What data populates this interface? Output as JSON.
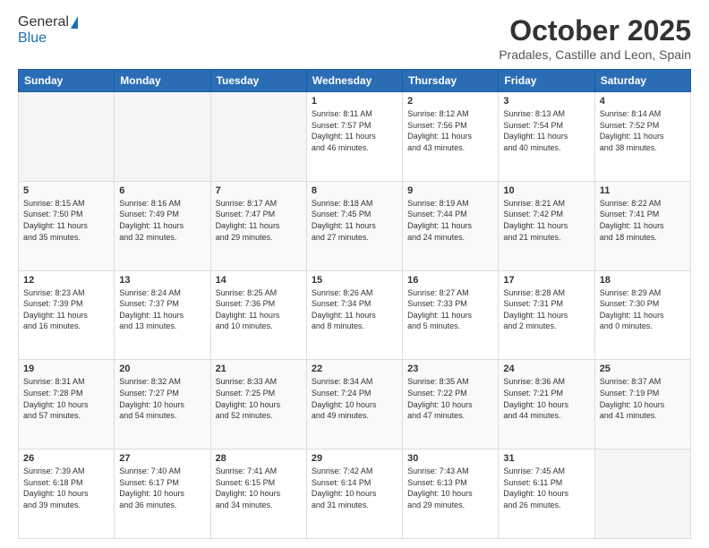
{
  "header": {
    "logo_general": "General",
    "logo_blue": "Blue",
    "month": "October 2025",
    "location": "Pradales, Castille and Leon, Spain"
  },
  "weekdays": [
    "Sunday",
    "Monday",
    "Tuesday",
    "Wednesday",
    "Thursday",
    "Friday",
    "Saturday"
  ],
  "weeks": [
    [
      {
        "day": "",
        "info": ""
      },
      {
        "day": "",
        "info": ""
      },
      {
        "day": "",
        "info": ""
      },
      {
        "day": "1",
        "info": "Sunrise: 8:11 AM\nSunset: 7:57 PM\nDaylight: 11 hours\nand 46 minutes."
      },
      {
        "day": "2",
        "info": "Sunrise: 8:12 AM\nSunset: 7:56 PM\nDaylight: 11 hours\nand 43 minutes."
      },
      {
        "day": "3",
        "info": "Sunrise: 8:13 AM\nSunset: 7:54 PM\nDaylight: 11 hours\nand 40 minutes."
      },
      {
        "day": "4",
        "info": "Sunrise: 8:14 AM\nSunset: 7:52 PM\nDaylight: 11 hours\nand 38 minutes."
      }
    ],
    [
      {
        "day": "5",
        "info": "Sunrise: 8:15 AM\nSunset: 7:50 PM\nDaylight: 11 hours\nand 35 minutes."
      },
      {
        "day": "6",
        "info": "Sunrise: 8:16 AM\nSunset: 7:49 PM\nDaylight: 11 hours\nand 32 minutes."
      },
      {
        "day": "7",
        "info": "Sunrise: 8:17 AM\nSunset: 7:47 PM\nDaylight: 11 hours\nand 29 minutes."
      },
      {
        "day": "8",
        "info": "Sunrise: 8:18 AM\nSunset: 7:45 PM\nDaylight: 11 hours\nand 27 minutes."
      },
      {
        "day": "9",
        "info": "Sunrise: 8:19 AM\nSunset: 7:44 PM\nDaylight: 11 hours\nand 24 minutes."
      },
      {
        "day": "10",
        "info": "Sunrise: 8:21 AM\nSunset: 7:42 PM\nDaylight: 11 hours\nand 21 minutes."
      },
      {
        "day": "11",
        "info": "Sunrise: 8:22 AM\nSunset: 7:41 PM\nDaylight: 11 hours\nand 18 minutes."
      }
    ],
    [
      {
        "day": "12",
        "info": "Sunrise: 8:23 AM\nSunset: 7:39 PM\nDaylight: 11 hours\nand 16 minutes."
      },
      {
        "day": "13",
        "info": "Sunrise: 8:24 AM\nSunset: 7:37 PM\nDaylight: 11 hours\nand 13 minutes."
      },
      {
        "day": "14",
        "info": "Sunrise: 8:25 AM\nSunset: 7:36 PM\nDaylight: 11 hours\nand 10 minutes."
      },
      {
        "day": "15",
        "info": "Sunrise: 8:26 AM\nSunset: 7:34 PM\nDaylight: 11 hours\nand 8 minutes."
      },
      {
        "day": "16",
        "info": "Sunrise: 8:27 AM\nSunset: 7:33 PM\nDaylight: 11 hours\nand 5 minutes."
      },
      {
        "day": "17",
        "info": "Sunrise: 8:28 AM\nSunset: 7:31 PM\nDaylight: 11 hours\nand 2 minutes."
      },
      {
        "day": "18",
        "info": "Sunrise: 8:29 AM\nSunset: 7:30 PM\nDaylight: 11 hours\nand 0 minutes."
      }
    ],
    [
      {
        "day": "19",
        "info": "Sunrise: 8:31 AM\nSunset: 7:28 PM\nDaylight: 10 hours\nand 57 minutes."
      },
      {
        "day": "20",
        "info": "Sunrise: 8:32 AM\nSunset: 7:27 PM\nDaylight: 10 hours\nand 54 minutes."
      },
      {
        "day": "21",
        "info": "Sunrise: 8:33 AM\nSunset: 7:25 PM\nDaylight: 10 hours\nand 52 minutes."
      },
      {
        "day": "22",
        "info": "Sunrise: 8:34 AM\nSunset: 7:24 PM\nDaylight: 10 hours\nand 49 minutes."
      },
      {
        "day": "23",
        "info": "Sunrise: 8:35 AM\nSunset: 7:22 PM\nDaylight: 10 hours\nand 47 minutes."
      },
      {
        "day": "24",
        "info": "Sunrise: 8:36 AM\nSunset: 7:21 PM\nDaylight: 10 hours\nand 44 minutes."
      },
      {
        "day": "25",
        "info": "Sunrise: 8:37 AM\nSunset: 7:19 PM\nDaylight: 10 hours\nand 41 minutes."
      }
    ],
    [
      {
        "day": "26",
        "info": "Sunrise: 7:39 AM\nSunset: 6:18 PM\nDaylight: 10 hours\nand 39 minutes."
      },
      {
        "day": "27",
        "info": "Sunrise: 7:40 AM\nSunset: 6:17 PM\nDaylight: 10 hours\nand 36 minutes."
      },
      {
        "day": "28",
        "info": "Sunrise: 7:41 AM\nSunset: 6:15 PM\nDaylight: 10 hours\nand 34 minutes."
      },
      {
        "day": "29",
        "info": "Sunrise: 7:42 AM\nSunset: 6:14 PM\nDaylight: 10 hours\nand 31 minutes."
      },
      {
        "day": "30",
        "info": "Sunrise: 7:43 AM\nSunset: 6:13 PM\nDaylight: 10 hours\nand 29 minutes."
      },
      {
        "day": "31",
        "info": "Sunrise: 7:45 AM\nSunset: 6:11 PM\nDaylight: 10 hours\nand 26 minutes."
      },
      {
        "day": "",
        "info": ""
      }
    ]
  ]
}
